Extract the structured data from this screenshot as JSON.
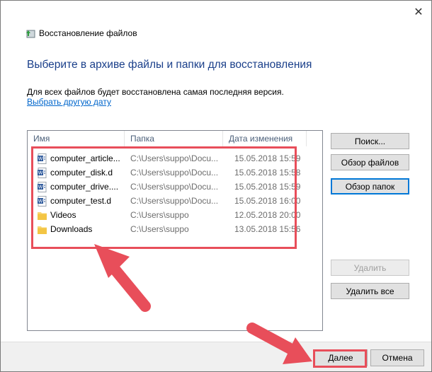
{
  "window": {
    "title": "Восстановление файлов",
    "close_glyph": "✕"
  },
  "heading": "Выберите в архиве файлы и папки для восстановления",
  "info_text": "Для всех файлов будет восстановлена самая последняя версия.",
  "choose_date_link": "Выбрать другую дату",
  "columns": {
    "name": "Имя",
    "folder": "Папка",
    "date": "Дата изменения"
  },
  "files": [
    {
      "name": "computer_article...",
      "folder": "C:\\Users\\suppo\\Docu...",
      "date": "15.05.2018 15:59",
      "icon": "word-document-icon"
    },
    {
      "name": "computer_disk.d",
      "folder": "C:\\Users\\suppo\\Docu...",
      "date": "15.05.2018 15:58",
      "icon": "word-document-icon"
    },
    {
      "name": "computer_drive....",
      "folder": "C:\\Users\\suppo\\Docu...",
      "date": "15.05.2018 15:59",
      "icon": "word-document-icon"
    },
    {
      "name": "computer_test.d",
      "folder": "C:\\Users\\suppo\\Docu...",
      "date": "15.05.2018 16:00",
      "icon": "word-document-icon"
    },
    {
      "name": "Videos",
      "folder": "C:\\Users\\suppo",
      "date": "12.05.2018 20:00",
      "icon": "folder-icon"
    },
    {
      "name": "Downloads",
      "folder": "C:\\Users\\suppo",
      "date": "13.05.2018 15:56",
      "icon": "folder-icon"
    }
  ],
  "side_buttons": {
    "search": "Поиск...",
    "browse_files": "Обзор файлов",
    "browse_folders": "Обзор папок",
    "remove": "Удалить",
    "remove_all": "Удалить все"
  },
  "footer": {
    "next": "Далее",
    "cancel": "Отмена"
  },
  "colors": {
    "accent": "#0078d7",
    "annotation_red": "#e84e5a",
    "heading_blue": "#1a3f8a"
  }
}
